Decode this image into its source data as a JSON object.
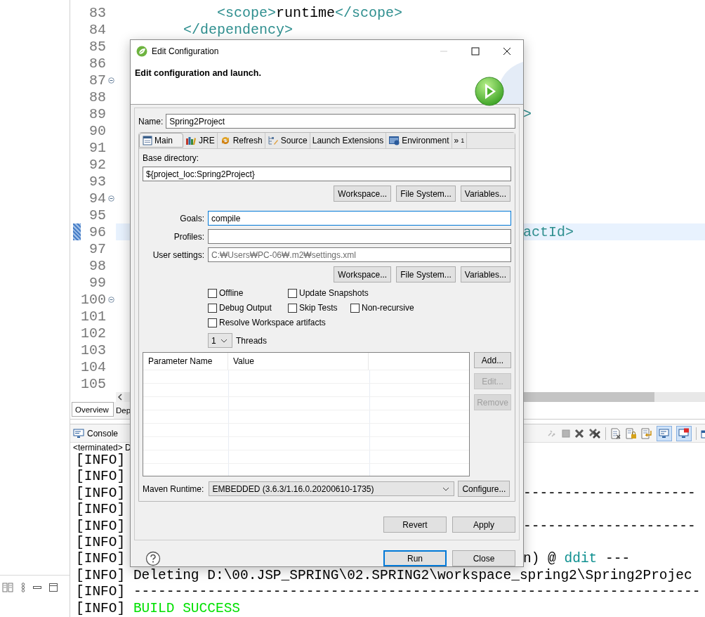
{
  "ide": {
    "editor": {
      "lines": [
        {
          "number": "83",
          "fold": false,
          "current": false,
          "segments": [
            {
              "kind": "tag",
              "text": "            <scope>"
            },
            {
              "kind": "text",
              "text": "runtime"
            },
            {
              "kind": "tag",
              "text": "</scope>"
            }
          ]
        },
        {
          "number": "84",
          "fold": false,
          "current": false,
          "segments": [
            {
              "kind": "tag",
              "text": "        </dependency>"
            }
          ]
        },
        {
          "number": "85",
          "fold": false,
          "current": false
        },
        {
          "number": "86",
          "fold": false,
          "current": false
        },
        {
          "number": "87",
          "fold": true,
          "current": false
        },
        {
          "number": "88",
          "fold": false,
          "current": false
        },
        {
          "number": "89",
          "fold": false,
          "current": false,
          "tail": [
            {
              "kind": "tag",
              "text": ">"
            }
          ]
        },
        {
          "number": "90",
          "fold": false,
          "current": false
        },
        {
          "number": "91",
          "fold": false,
          "current": false
        },
        {
          "number": "92",
          "fold": false,
          "current": false
        },
        {
          "number": "93",
          "fold": false,
          "current": false
        },
        {
          "number": "94",
          "fold": true,
          "current": false
        },
        {
          "number": "95",
          "fold": false,
          "current": false
        },
        {
          "number": "96",
          "fold": false,
          "current": true,
          "tail": [
            {
              "kind": "tag",
              "text": "actId>"
            }
          ]
        },
        {
          "number": "97",
          "fold": false,
          "current": false
        },
        {
          "number": "98",
          "fold": false,
          "current": false
        },
        {
          "number": "99",
          "fold": false,
          "current": false
        },
        {
          "number": "100",
          "fold": true,
          "current": false
        },
        {
          "number": "101",
          "fold": false,
          "current": false
        },
        {
          "number": "102",
          "fold": false,
          "current": false
        },
        {
          "number": "103",
          "fold": false,
          "current": false
        },
        {
          "number": "104",
          "fold": false,
          "current": false
        },
        {
          "number": "105",
          "fold": false,
          "current": false
        }
      ]
    },
    "editor_tabs": [
      {
        "label": "Overview",
        "selected": true
      },
      {
        "label": "Dep",
        "selected": false
      }
    ],
    "console": {
      "title": "Console",
      "status": "<terminated> D",
      "toggles": [
        {
          "kind": "stdout",
          "on": true
        },
        {
          "kind": "stderr",
          "on": true
        }
      ],
      "lines": [
        {
          "tag": "[INFO]"
        },
        {
          "tag": "[INFO]"
        },
        {
          "tag": "[INFO]",
          "tail": [
            {
              "kind": "text",
              "text": "---------------------"
            }
          ]
        },
        {
          "tag": "[INFO]"
        },
        {
          "tag": "[INFO]",
          "tail": [
            {
              "kind": "text",
              "text": "---------------------"
            }
          ]
        },
        {
          "tag": "[INFO]"
        },
        {
          "tag": "[INFO]",
          "tail": [
            {
              "kind": "text",
              "text": "n) @ "
            },
            {
              "kind": "project",
              "text": "ddit"
            },
            {
              "kind": "text",
              "text": " ---"
            }
          ]
        },
        {
          "tag": "[INFO]",
          "segments": [
            {
              "kind": "text",
              "text": "Deleting D:\\00.JSP_SPRING\\02.SPRING2\\workspace_spring2\\Spring2Projec"
            }
          ]
        },
        {
          "tag": "[INFO]",
          "segments": [
            {
              "kind": "text",
              "text": "---------------------------------------------------------------------"
            }
          ]
        },
        {
          "tag": "[INFO]",
          "segments": [
            {
              "kind": "success",
              "text": "BUILD SUCCESS"
            }
          ]
        }
      ]
    }
  },
  "dialog": {
    "title": "Edit Configuration",
    "heading": "Edit configuration and launch.",
    "name_label": "Name:",
    "name": "Spring2Project",
    "tabs": [
      {
        "label": "Main",
        "kind": "page",
        "selected": true
      },
      {
        "label": "JRE",
        "kind": "books",
        "selected": false
      },
      {
        "label": "Refresh",
        "kind": "refresh",
        "selected": false
      },
      {
        "label": "Source",
        "kind": "source",
        "selected": false
      },
      {
        "label": "Launch Extensions",
        "kind": "plain",
        "selected": false
      },
      {
        "label": "Environment",
        "kind": "environment",
        "selected": false
      }
    ],
    "more_tabs": {
      "symbol": "»",
      "count": "1"
    },
    "base_directory": {
      "label": "Base directory:",
      "value": "${project_loc:Spring2Project}",
      "buttons": [
        "Workspace...",
        "File System...",
        "Variables..."
      ]
    },
    "fields": [
      {
        "label": "Goals:",
        "value": "compile",
        "focused": true
      },
      {
        "label": "Profiles:",
        "focused": false
      },
      {
        "label": "User settings:",
        "placeholder": "C:₩Users₩PC-06₩.m2₩settings.xml",
        "focused": false
      }
    ],
    "settings_buttons": [
      "Workspace...",
      "File System...",
      "Variables..."
    ],
    "option_rows": [
      {
        "options": [
          {
            "label": "Offline",
            "checked": false
          },
          {
            "label": "Update Snapshots",
            "checked": false
          }
        ]
      },
      {
        "options": [
          {
            "label": "Debug Output",
            "checked": false
          },
          {
            "label": "Skip Tests",
            "checked": false
          },
          {
            "label": "Non-recursive",
            "checked": false
          }
        ]
      },
      {
        "options": [
          {
            "label": "Resolve Workspace artifacts",
            "checked": false
          }
        ]
      }
    ],
    "threads": {
      "value": "1",
      "label": "Threads"
    },
    "parameters": {
      "columns": [
        "Parameter Name",
        "Value"
      ],
      "buttons": [
        {
          "label": "Add...",
          "disabled": false
        },
        {
          "label": "Edit...",
          "disabled": true
        },
        {
          "label": "Remove",
          "disabled": true
        }
      ]
    },
    "maven_runtime": {
      "label": "Maven Runtime:",
      "value": "EMBEDDED (3.6.3/1.16.0.20200610-1735)",
      "button": "Configure..."
    },
    "actions": [
      {
        "label": "Revert",
        "disabled": false
      },
      {
        "label": "Apply",
        "disabled": false
      }
    ],
    "footer_buttons": [
      {
        "label": "Run",
        "default": true
      },
      {
        "label": "Close",
        "default": false
      }
    ]
  }
}
